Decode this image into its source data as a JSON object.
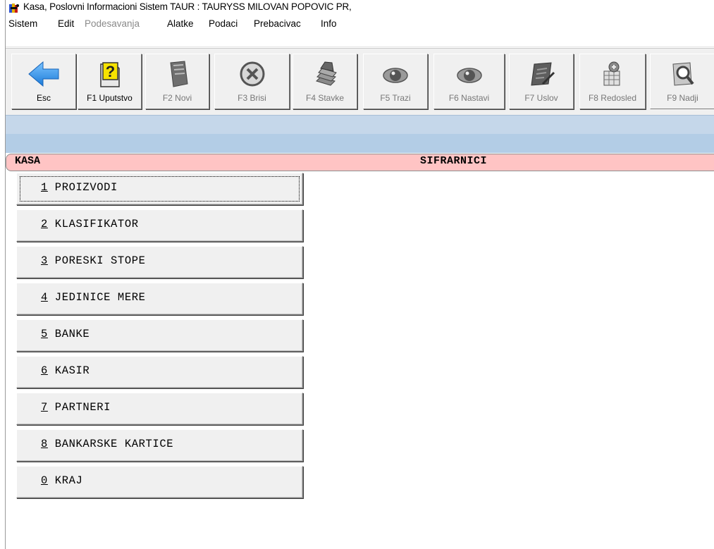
{
  "window": {
    "title": "Kasa, Poslovni Informacioni Sistem TAUR : TAURYSS MILOVAN POPOVIC PR,",
    "icon": "app-logo-icon"
  },
  "menu": [
    {
      "label": "Sistem",
      "enabled": true
    },
    {
      "label": "Edit",
      "enabled": true
    },
    {
      "label": "Podesavanja",
      "enabled": false
    },
    {
      "label": "Alatke",
      "enabled": true
    },
    {
      "label": "Podaci",
      "enabled": true
    },
    {
      "label": "Prebacivac",
      "enabled": true
    },
    {
      "label": "Info",
      "enabled": true
    }
  ],
  "toolbar": [
    {
      "label": "Esc",
      "icon": "back-arrow-icon",
      "enabled": true
    },
    {
      "label": "F1 Uputstvo",
      "icon": "help-icon",
      "enabled": true
    },
    {
      "label": "F2 Novi",
      "icon": "new-document-icon",
      "enabled": false
    },
    {
      "label": "F3 Brisi",
      "icon": "delete-icon",
      "enabled": false
    },
    {
      "label": "F4 Stavke",
      "icon": "items-stack-icon",
      "enabled": false
    },
    {
      "label": "F5 Trazi",
      "icon": "eye-icon",
      "enabled": false
    },
    {
      "label": "F6 Nastavi",
      "icon": "eye-icon",
      "enabled": false
    },
    {
      "label": "F7 Uslov",
      "icon": "condition-icon",
      "enabled": false
    },
    {
      "label": "F8 Redosled",
      "icon": "sort-icon",
      "enabled": false
    },
    {
      "label": "F9 Nadji",
      "icon": "find-icon",
      "enabled": false
    }
  ],
  "header": {
    "left": "KASA",
    "center": "SIFRARNICI"
  },
  "items": [
    {
      "key": "1",
      "label": " PROIZVODI"
    },
    {
      "key": "2",
      "label": " KLASIFIKATOR"
    },
    {
      "key": "3",
      "label": " PORESKI STOPE"
    },
    {
      "key": "4",
      "label": " JEDINICE MERE"
    },
    {
      "key": "5",
      "label": " BANKE"
    },
    {
      "key": "6",
      "label": " KASIR"
    },
    {
      "key": "7",
      "label": " PARTNERI"
    },
    {
      "key": "8",
      "label": " BANKARSKE KARTICE"
    },
    {
      "key": "0",
      "label": " KRAJ"
    }
  ],
  "colors": {
    "header_pink": "#ffc4c4",
    "strip_blue": "#b3cde6",
    "button_face": "#f0f0f0",
    "arrow_blue": "#2f8fe0",
    "help_yellow": "#f2d400"
  }
}
